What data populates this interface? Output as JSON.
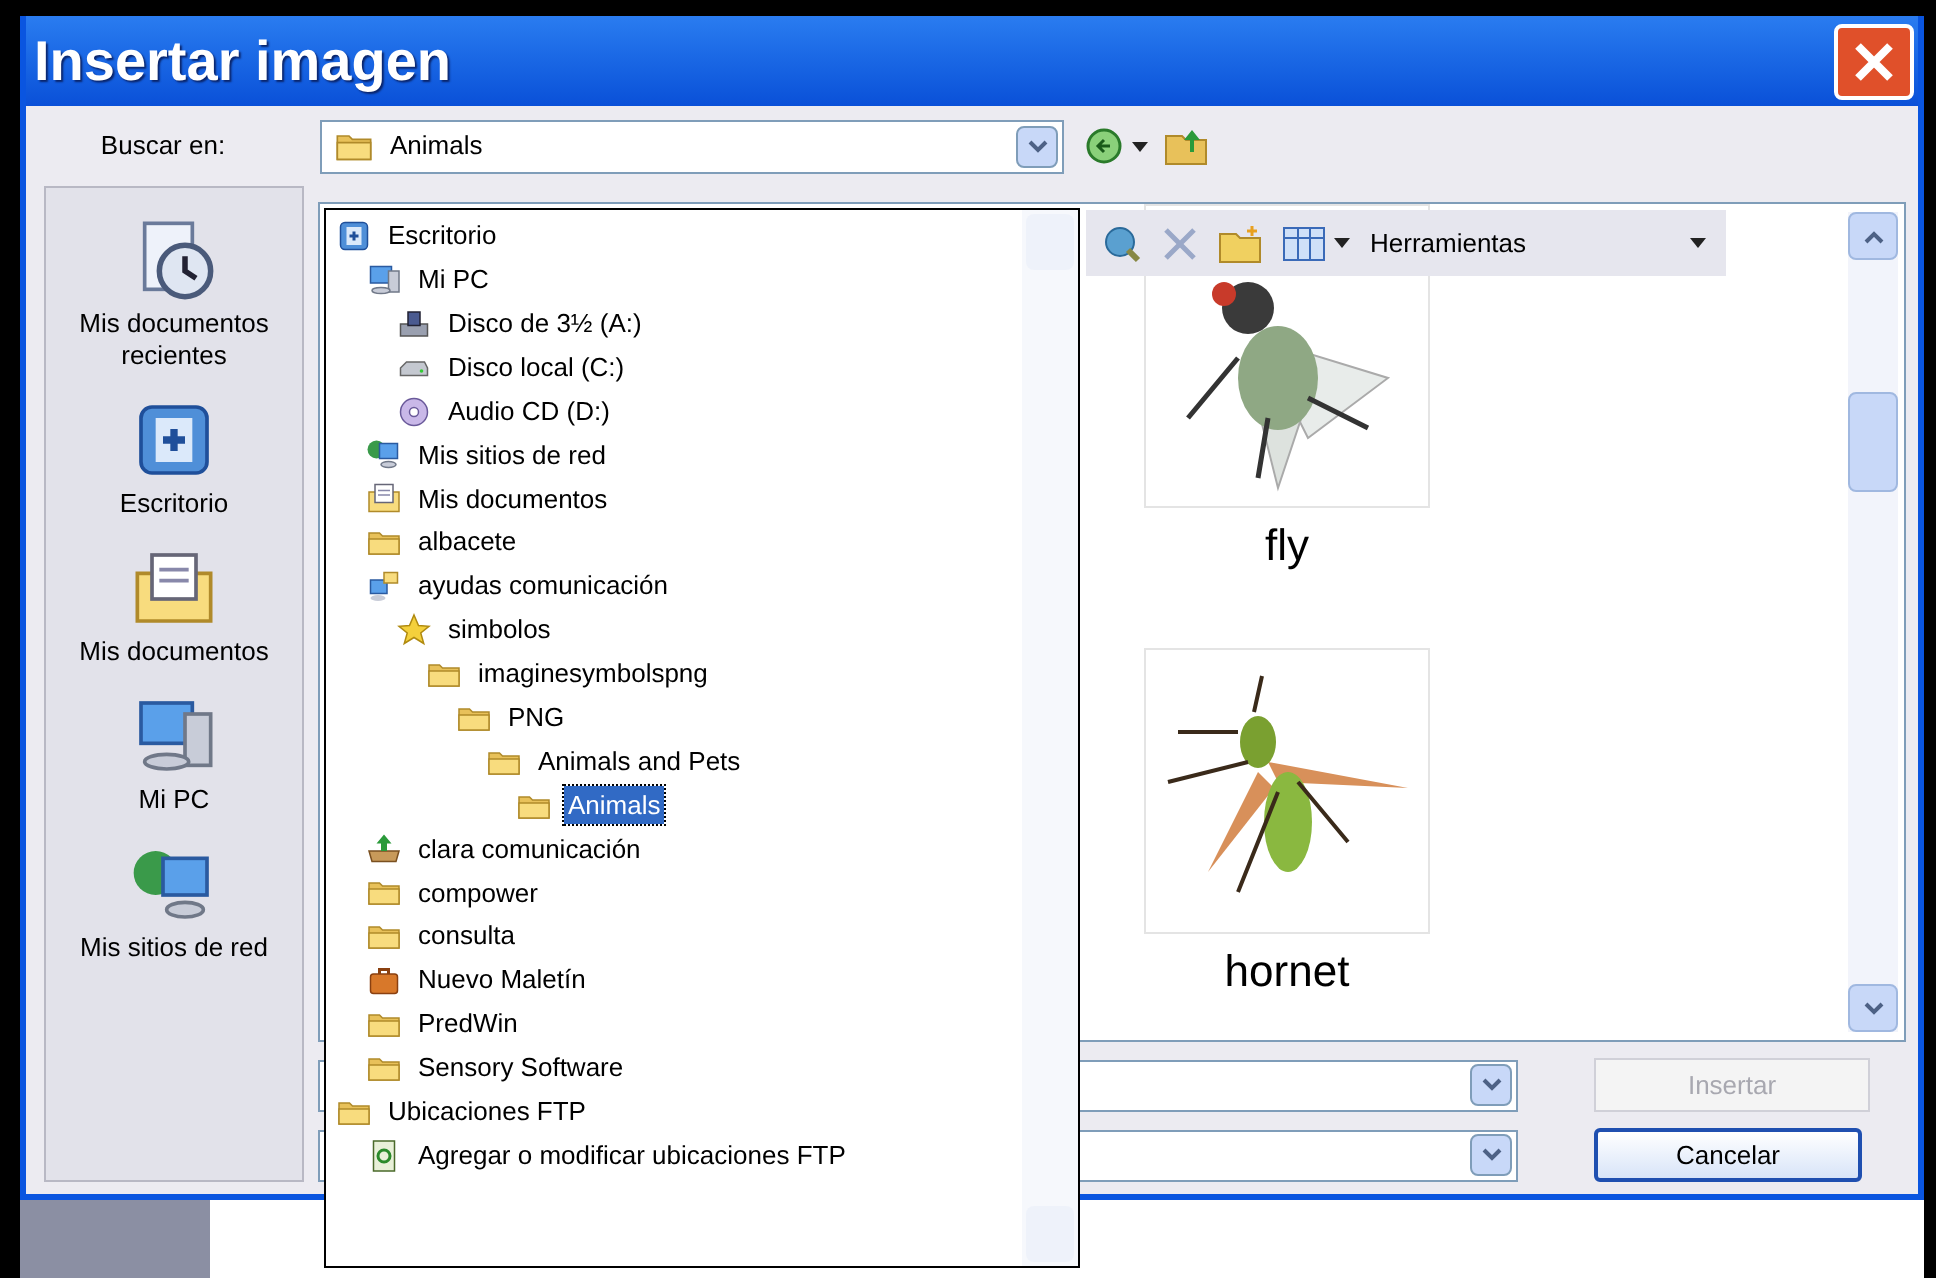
{
  "window": {
    "title": "Insertar imagen"
  },
  "look_in": {
    "label": "Buscar en:",
    "value": "Animals"
  },
  "places": [
    {
      "kind": "recent",
      "label": "Mis documentos recientes"
    },
    {
      "kind": "desktop",
      "label": "Escritorio"
    },
    {
      "kind": "documents",
      "label": "Mis documentos"
    },
    {
      "kind": "computer",
      "label": "Mi PC"
    },
    {
      "kind": "network",
      "label": "Mis sitios de red"
    }
  ],
  "tree": [
    {
      "kind": "desktop",
      "label": "Escritorio",
      "selected": false,
      "children": [
        {
          "kind": "computer",
          "label": "Mi PC",
          "selected": false,
          "children": [
            {
              "kind": "floppy",
              "label": "Disco de 3½ (A:)",
              "selected": false
            },
            {
              "kind": "drive",
              "label": "Disco local (C:)",
              "selected": false
            },
            {
              "kind": "cd",
              "label": "Audio CD (D:)",
              "selected": false
            }
          ]
        },
        {
          "kind": "network",
          "label": "Mis sitios de red",
          "selected": false
        },
        {
          "kind": "documents",
          "label": "Mis documentos",
          "selected": false
        },
        {
          "kind": "folder",
          "label": "albacete",
          "selected": false
        },
        {
          "kind": "shared",
          "label": "ayudas comunicación",
          "selected": false,
          "children": [
            {
              "kind": "star",
              "label": "simbolos",
              "selected": false,
              "children": [
                {
                  "kind": "folder",
                  "label": "imaginesymbolspng",
                  "selected": false,
                  "children": [
                    {
                      "kind": "folder",
                      "label": "PNG",
                      "selected": false,
                      "children": [
                        {
                          "kind": "folder",
                          "label": "Animals and Pets",
                          "selected": false,
                          "children": [
                            {
                              "kind": "folder",
                              "label": "Animals",
                              "selected": true
                            }
                          ]
                        }
                      ]
                    }
                  ]
                }
              ]
            }
          ]
        },
        {
          "kind": "tray",
          "label": "clara comunicación",
          "selected": false
        },
        {
          "kind": "folder",
          "label": "compower",
          "selected": false
        },
        {
          "kind": "folder",
          "label": "consulta",
          "selected": false
        },
        {
          "kind": "briefcase",
          "label": "Nuevo Maletín",
          "selected": false
        },
        {
          "kind": "folder",
          "label": "PredWin",
          "selected": false
        },
        {
          "kind": "folder",
          "label": "Sensory Software",
          "selected": false
        }
      ]
    },
    {
      "kind": "folder",
      "label": "Ubicaciones FTP",
      "selected": false,
      "children": [
        {
          "kind": "ftp",
          "label": "Agregar o modificar ubicaciones FTP",
          "selected": false
        }
      ]
    }
  ],
  "toolbar": {
    "menu": "Herramientas"
  },
  "files": [
    {
      "kind": "fly",
      "name": "fly"
    },
    {
      "kind": "hornet",
      "name": "hornet"
    }
  ],
  "buttons": [
    {
      "label": "Insertar",
      "disabled": true
    },
    {
      "label": "Cancelar",
      "disabled": false
    }
  ]
}
